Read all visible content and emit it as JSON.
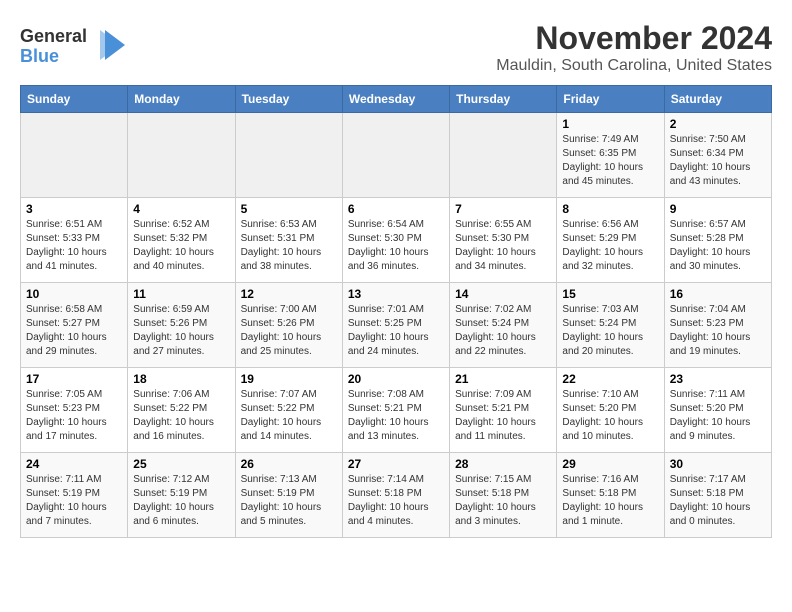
{
  "logo": {
    "line1": "General",
    "line2": "Blue"
  },
  "title": "November 2024",
  "location": "Mauldin, South Carolina, United States",
  "days_of_week": [
    "Sunday",
    "Monday",
    "Tuesday",
    "Wednesday",
    "Thursday",
    "Friday",
    "Saturday"
  ],
  "weeks": [
    [
      {
        "day": "",
        "info": ""
      },
      {
        "day": "",
        "info": ""
      },
      {
        "day": "",
        "info": ""
      },
      {
        "day": "",
        "info": ""
      },
      {
        "day": "",
        "info": ""
      },
      {
        "day": "1",
        "info": "Sunrise: 7:49 AM\nSunset: 6:35 PM\nDaylight: 10 hours and 45 minutes."
      },
      {
        "day": "2",
        "info": "Sunrise: 7:50 AM\nSunset: 6:34 PM\nDaylight: 10 hours and 43 minutes."
      }
    ],
    [
      {
        "day": "3",
        "info": "Sunrise: 6:51 AM\nSunset: 5:33 PM\nDaylight: 10 hours and 41 minutes."
      },
      {
        "day": "4",
        "info": "Sunrise: 6:52 AM\nSunset: 5:32 PM\nDaylight: 10 hours and 40 minutes."
      },
      {
        "day": "5",
        "info": "Sunrise: 6:53 AM\nSunset: 5:31 PM\nDaylight: 10 hours and 38 minutes."
      },
      {
        "day": "6",
        "info": "Sunrise: 6:54 AM\nSunset: 5:30 PM\nDaylight: 10 hours and 36 minutes."
      },
      {
        "day": "7",
        "info": "Sunrise: 6:55 AM\nSunset: 5:30 PM\nDaylight: 10 hours and 34 minutes."
      },
      {
        "day": "8",
        "info": "Sunrise: 6:56 AM\nSunset: 5:29 PM\nDaylight: 10 hours and 32 minutes."
      },
      {
        "day": "9",
        "info": "Sunrise: 6:57 AM\nSunset: 5:28 PM\nDaylight: 10 hours and 30 minutes."
      }
    ],
    [
      {
        "day": "10",
        "info": "Sunrise: 6:58 AM\nSunset: 5:27 PM\nDaylight: 10 hours and 29 minutes."
      },
      {
        "day": "11",
        "info": "Sunrise: 6:59 AM\nSunset: 5:26 PM\nDaylight: 10 hours and 27 minutes."
      },
      {
        "day": "12",
        "info": "Sunrise: 7:00 AM\nSunset: 5:26 PM\nDaylight: 10 hours and 25 minutes."
      },
      {
        "day": "13",
        "info": "Sunrise: 7:01 AM\nSunset: 5:25 PM\nDaylight: 10 hours and 24 minutes."
      },
      {
        "day": "14",
        "info": "Sunrise: 7:02 AM\nSunset: 5:24 PM\nDaylight: 10 hours and 22 minutes."
      },
      {
        "day": "15",
        "info": "Sunrise: 7:03 AM\nSunset: 5:24 PM\nDaylight: 10 hours and 20 minutes."
      },
      {
        "day": "16",
        "info": "Sunrise: 7:04 AM\nSunset: 5:23 PM\nDaylight: 10 hours and 19 minutes."
      }
    ],
    [
      {
        "day": "17",
        "info": "Sunrise: 7:05 AM\nSunset: 5:23 PM\nDaylight: 10 hours and 17 minutes."
      },
      {
        "day": "18",
        "info": "Sunrise: 7:06 AM\nSunset: 5:22 PM\nDaylight: 10 hours and 16 minutes."
      },
      {
        "day": "19",
        "info": "Sunrise: 7:07 AM\nSunset: 5:22 PM\nDaylight: 10 hours and 14 minutes."
      },
      {
        "day": "20",
        "info": "Sunrise: 7:08 AM\nSunset: 5:21 PM\nDaylight: 10 hours and 13 minutes."
      },
      {
        "day": "21",
        "info": "Sunrise: 7:09 AM\nSunset: 5:21 PM\nDaylight: 10 hours and 11 minutes."
      },
      {
        "day": "22",
        "info": "Sunrise: 7:10 AM\nSunset: 5:20 PM\nDaylight: 10 hours and 10 minutes."
      },
      {
        "day": "23",
        "info": "Sunrise: 7:11 AM\nSunset: 5:20 PM\nDaylight: 10 hours and 9 minutes."
      }
    ],
    [
      {
        "day": "24",
        "info": "Sunrise: 7:11 AM\nSunset: 5:19 PM\nDaylight: 10 hours and 7 minutes."
      },
      {
        "day": "25",
        "info": "Sunrise: 7:12 AM\nSunset: 5:19 PM\nDaylight: 10 hours and 6 minutes."
      },
      {
        "day": "26",
        "info": "Sunrise: 7:13 AM\nSunset: 5:19 PM\nDaylight: 10 hours and 5 minutes."
      },
      {
        "day": "27",
        "info": "Sunrise: 7:14 AM\nSunset: 5:18 PM\nDaylight: 10 hours and 4 minutes."
      },
      {
        "day": "28",
        "info": "Sunrise: 7:15 AM\nSunset: 5:18 PM\nDaylight: 10 hours and 3 minutes."
      },
      {
        "day": "29",
        "info": "Sunrise: 7:16 AM\nSunset: 5:18 PM\nDaylight: 10 hours and 1 minute."
      },
      {
        "day": "30",
        "info": "Sunrise: 7:17 AM\nSunset: 5:18 PM\nDaylight: 10 hours and 0 minutes."
      }
    ]
  ]
}
